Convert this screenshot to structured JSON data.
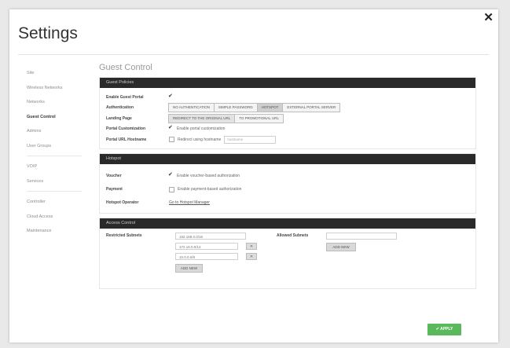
{
  "dialog": {
    "title": "Settings",
    "close_icon": "close-icon"
  },
  "sidebar": {
    "items": [
      {
        "label": "Site",
        "active": false
      },
      {
        "label": "Wireless Networks",
        "active": false
      },
      {
        "label": "Networks",
        "active": false
      },
      {
        "label": "Guest Control",
        "active": true
      },
      {
        "label": "Admins",
        "active": false
      },
      {
        "label": "User Groups",
        "active": false
      },
      {
        "label": "VOIP",
        "active": false
      },
      {
        "label": "Services",
        "active": false
      },
      {
        "label": "Controller",
        "active": false
      },
      {
        "label": "Cloud Access",
        "active": false
      },
      {
        "label": "Maintenance",
        "active": false
      }
    ]
  },
  "main": {
    "section_title": "Guest Control",
    "guest_policies": {
      "header": "Guest Policies",
      "enable_label": "Enable Guest Portal",
      "enable_checked": true,
      "auth_label": "Authentication",
      "auth_options": [
        "NO AUTHENTICATION",
        "SIMPLE PASSWORD",
        "HOTSPOT",
        "EXTERNAL PORTAL SERVER"
      ],
      "auth_selected": 2,
      "landing_label": "Landing Page",
      "landing_options": [
        "REDIRECT TO THE ORIGINAL URL",
        "TO PROMOTIONAL URL"
      ],
      "customization_label": "Portal Customization",
      "customization_text": "Enable portal customization",
      "customization_checked": true,
      "hostname_label": "Portal URL Hostname",
      "hostname_text": "Redirect using hostname",
      "hostname_checked": false,
      "hostname_placeholder": "hostname"
    },
    "hotspot": {
      "header": "Hotspot",
      "voucher_label": "Voucher",
      "voucher_text": "Enable voucher-based authorization",
      "voucher_checked": true,
      "payment_label": "Payment",
      "payment_text": "Enable payment-based authorization",
      "payment_checked": false,
      "operator_label": "Hotspot Operator",
      "operator_link": "Go to Hotspot Manager"
    },
    "access_control": {
      "header": "Access Control",
      "restricted_label": "Restricted Subnets",
      "restricted_subnets": [
        "192.168.0.0/16",
        "172.16.0.0/12",
        "10.0.0.0/8"
      ],
      "allowed_label": "Allowed Subnets",
      "allowed_value": "",
      "add_new_label": "ADD NEW",
      "remove_icon": "remove-x-icon"
    }
  },
  "footer": {
    "apply_label": "✔ APPLY"
  }
}
